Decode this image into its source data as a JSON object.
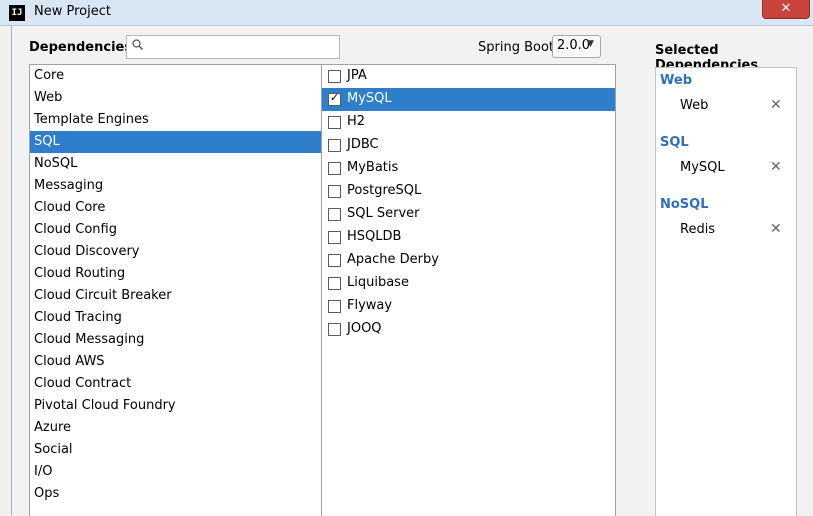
{
  "window": {
    "title": "New Project",
    "app_icon": "IJ",
    "close_icon": "close-icon"
  },
  "header": {
    "dependencies_label": "Dependencies",
    "search": {
      "value": "",
      "placeholder": ""
    },
    "spring_boot_label": "Spring Boot",
    "spring_boot_version": "2.0.0"
  },
  "categories": [
    "Core",
    "Web",
    "Template Engines",
    "SQL",
    "NoSQL",
    "Messaging",
    "Cloud Core",
    "Cloud Config",
    "Cloud Discovery",
    "Cloud Routing",
    "Cloud Circuit Breaker",
    "Cloud Tracing",
    "Cloud Messaging",
    "Cloud AWS",
    "Cloud Contract",
    "Pivotal Cloud Foundry",
    "Azure",
    "Social",
    "I/O",
    "Ops"
  ],
  "selected_category": "SQL",
  "dependencies": [
    {
      "label": "JPA",
      "checked": false
    },
    {
      "label": "MySQL",
      "checked": true
    },
    {
      "label": "H2",
      "checked": false
    },
    {
      "label": "JDBC",
      "checked": false
    },
    {
      "label": "MyBatis",
      "checked": false
    },
    {
      "label": "PostgreSQL",
      "checked": false
    },
    {
      "label": "SQL Server",
      "checked": false
    },
    {
      "label": "HSQLDB",
      "checked": false
    },
    {
      "label": "Apache Derby",
      "checked": false
    },
    {
      "label": "Liquibase",
      "checked": false
    },
    {
      "label": "Flyway",
      "checked": false
    },
    {
      "label": "JOOQ",
      "checked": false
    }
  ],
  "selected_dependency": "MySQL",
  "selected_panel": {
    "title": "Selected Dependencies",
    "groups": [
      {
        "name": "Web",
        "items": [
          "Web"
        ]
      },
      {
        "name": "SQL",
        "items": [
          "MySQL"
        ]
      },
      {
        "name": "NoSQL",
        "items": [
          "Redis"
        ]
      }
    ],
    "remove_symbol": "✕"
  },
  "colors": {
    "selection": "#2f7ecb",
    "group_title": "#2f6fb5",
    "close": "#c9433a"
  }
}
